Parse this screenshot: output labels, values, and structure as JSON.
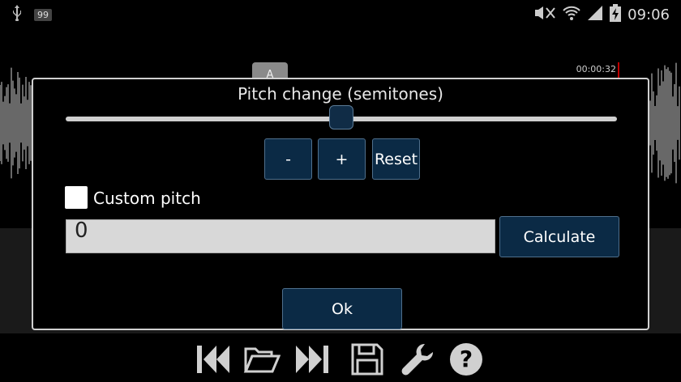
{
  "status_bar": {
    "notification_count": "99",
    "clock": "09:06"
  },
  "editor": {
    "marker_a_label": "A",
    "playhead_time": "00:00:32"
  },
  "dialog": {
    "title": "Pitch change (semitones)",
    "slider_level": 0.5,
    "minus_label": "-",
    "plus_label": "+",
    "reset_label": "Reset",
    "custom_pitch_label": "Custom pitch",
    "custom_pitch_checked": false,
    "pitch_value": "0",
    "calculate_label": "Calculate",
    "ok_label": "Ok"
  },
  "toolbar_icons": [
    "skip-back-icon",
    "folder-open-icon",
    "skip-forward-icon",
    "save-icon",
    "wrench-icon",
    "help-icon"
  ],
  "colors": {
    "button_bg": "#0b2a45",
    "playhead": "#c00000"
  }
}
